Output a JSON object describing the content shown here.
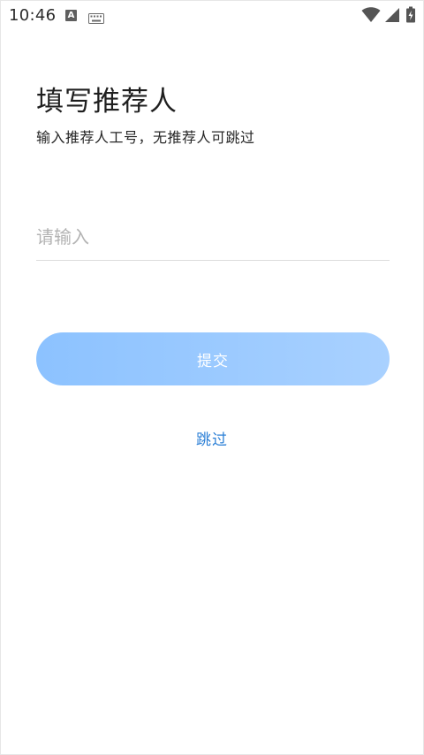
{
  "status_bar": {
    "time": "10:46",
    "notification_badge": "A",
    "icons": [
      "a-notification-icon",
      "keyboard-icon",
      "wifi-icon",
      "signal-icon",
      "battery-charging-icon"
    ]
  },
  "page": {
    "title": "填写推荐人",
    "subtitle": "输入推荐人工号，无推荐人可跳过"
  },
  "form": {
    "input_value": "",
    "input_placeholder": "请输入",
    "submit_label": "提交",
    "skip_label": "跳过"
  },
  "colors": {
    "accent": "#2b7fd6",
    "button_gradient_start": "#8cc2ff",
    "button_gradient_end": "#a9d1ff"
  }
}
